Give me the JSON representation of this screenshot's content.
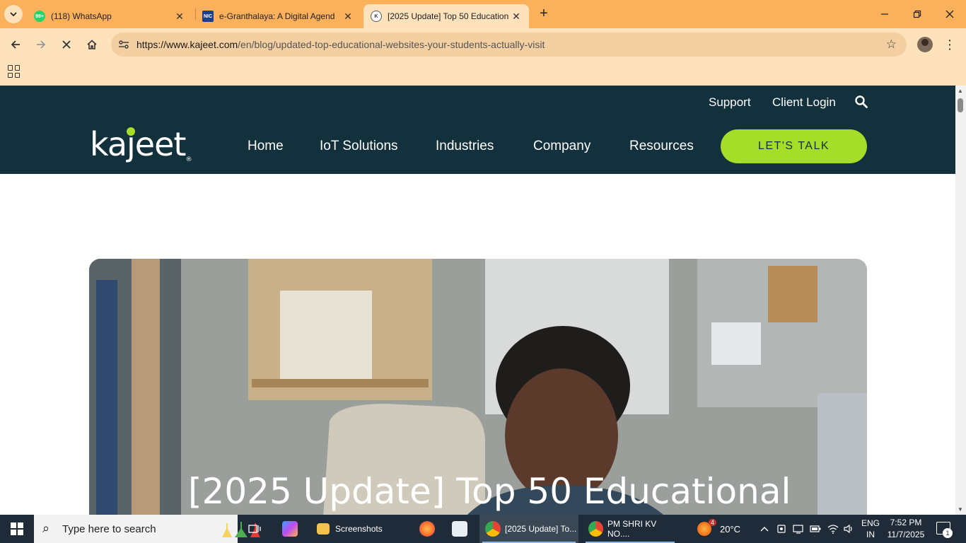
{
  "browser": {
    "tabs": [
      {
        "title": "(118) WhatsApp",
        "favicon_badge": "99+"
      },
      {
        "title": "e-Granthalaya: A Digital Agend",
        "favicon_badge": "NIC"
      },
      {
        "title": "[2025 Update] Top 50 Education",
        "favicon_badge": "K"
      }
    ],
    "url_host": "https://www.kajeet.com",
    "url_path": "/en/blog/updated-top-educational-websites-your-students-actually-visit"
  },
  "site": {
    "utility_links": [
      "Support",
      "Client Login"
    ],
    "logo_text": "kajeet",
    "logo_reg": "®",
    "nav": [
      "Home",
      "IoT Solutions",
      "Industries",
      "Company",
      "Resources"
    ],
    "cta_label": "LET'S TALK",
    "hero_title": "[2025 Update] Top 50 Educational"
  },
  "taskbar": {
    "search_placeholder": "Type here to search",
    "apps": [
      {
        "label": "Screenshots"
      },
      {
        "label": "[2025 Update] To..."
      },
      {
        "label": "PM SHRI KV NO...."
      }
    ],
    "weather_temp": "20°C",
    "weather_badge": "4",
    "language": "ENG",
    "region": "IN",
    "time": "7:52 PM",
    "date": "11/7/2025",
    "notification_count": "1"
  },
  "colors": {
    "tabstrip": "#fbb05b",
    "toolbar": "#fde2bc",
    "site_header": "#13313d",
    "cta": "#a6dd28"
  }
}
